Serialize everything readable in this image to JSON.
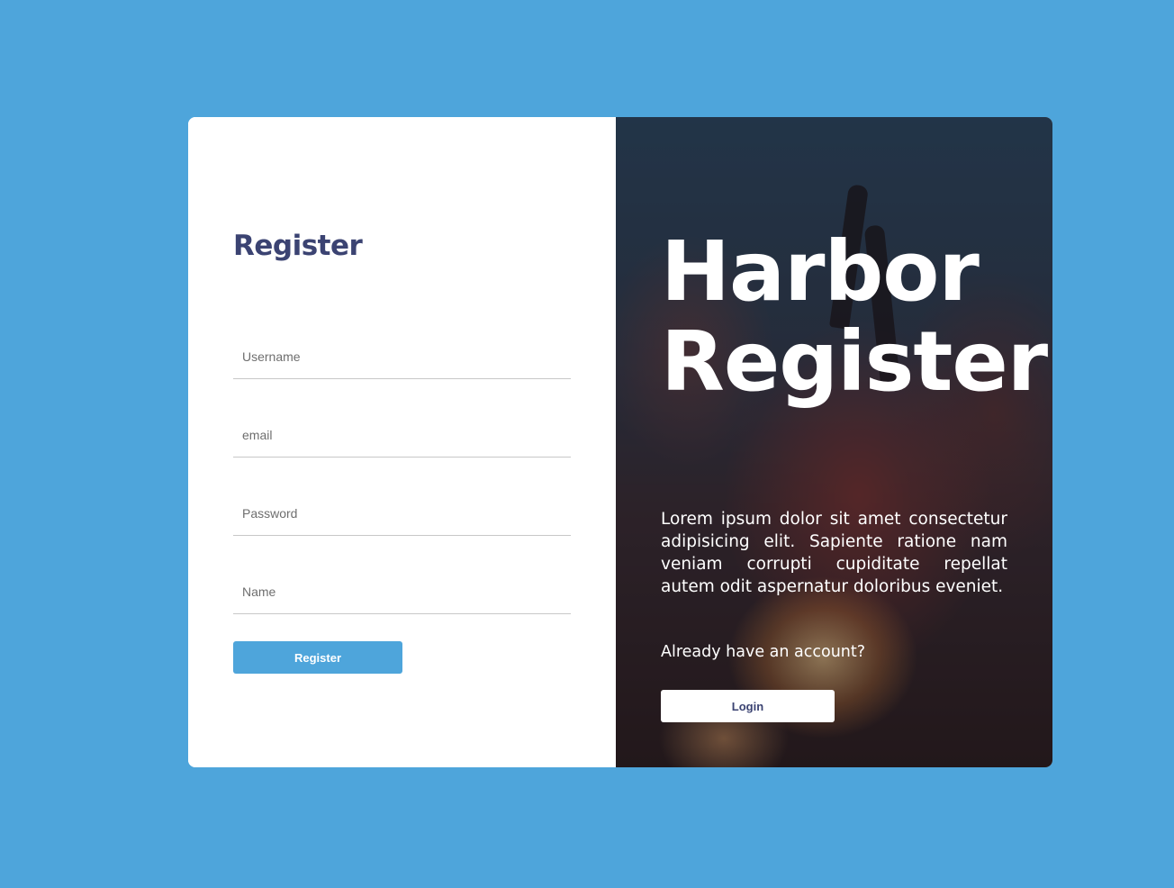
{
  "page": {
    "background_color": "#4ea5db"
  },
  "register_form": {
    "title": "Register",
    "fields": [
      {
        "name": "username",
        "placeholder": "Username",
        "value": ""
      },
      {
        "name": "email",
        "placeholder": "email",
        "value": ""
      },
      {
        "name": "password",
        "placeholder": "Password",
        "value": ""
      },
      {
        "name": "name",
        "placeholder": "Name",
        "value": ""
      }
    ],
    "submit_label": "Register",
    "accent_color": "#4ea5db",
    "title_color": "#3b4372"
  },
  "hero": {
    "title_line1": "Harbor",
    "title_line2": "Register",
    "description": "Lorem ipsum dolor sit amet consectetur adipisicing elit. Sapiente ratione nam veniam corrupti cupiditate repellat autem odit aspernatur doloribus eveniet.",
    "already_text": "Already have an account?",
    "login_label": "Login",
    "background_image": "friends-toasting-bottles-by-campfire-photo"
  }
}
